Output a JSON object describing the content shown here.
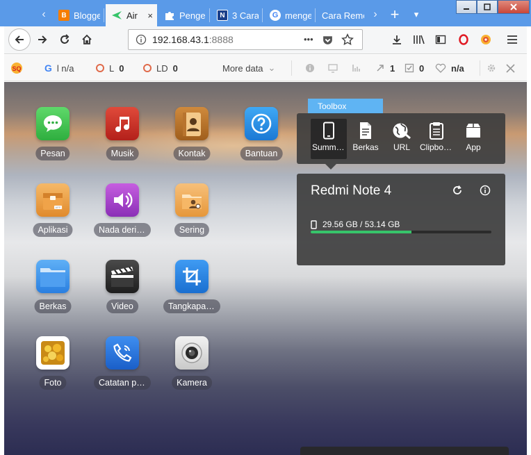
{
  "browser": {
    "tabs": [
      {
        "label": "Blogge",
        "favicon": "blogger-icon",
        "color": "#f57d00",
        "glyph": "B"
      },
      {
        "label": "Air",
        "favicon": "airdroid-icon",
        "color": "#37c46a",
        "glyph": "",
        "active": true
      },
      {
        "label": "Penge",
        "favicon": "puzzle-icon",
        "color": "#ffffff",
        "glyph": ""
      },
      {
        "label": "3 Cara",
        "favicon": "n-icon",
        "color": "#1a3f8a",
        "glyph": "N"
      },
      {
        "label": "menge",
        "favicon": "google-icon",
        "color": "#ffffff",
        "glyph": "G"
      },
      {
        "label": "Cara Remo",
        "favicon": "",
        "color": "",
        "glyph": ""
      }
    ],
    "new_tab": "+",
    "url": "192.168.43.1",
    "url_port": ":8888",
    "url_more": "•••"
  },
  "airdroid_bar": {
    "g_label": "l n/a",
    "l_label": "L",
    "l_value": "0",
    "ld_label": "LD",
    "ld_value": "0",
    "more_data": "More data",
    "arrow_count": "1",
    "check_count": "0",
    "health_value": "n/a"
  },
  "apps": [
    {
      "label": "Pesan",
      "icon": "message-icon"
    },
    {
      "label": "Musik",
      "icon": "music-icon"
    },
    {
      "label": "Kontak",
      "icon": "contact-icon"
    },
    {
      "label": "Bantuan",
      "icon": "help-icon"
    },
    {
      "label": "Aplikasi",
      "icon": "apps-box-icon"
    },
    {
      "label": "Nada dering",
      "icon": "ringtone-icon"
    },
    {
      "label": "Sering",
      "icon": "frequent-icon"
    },
    {
      "label": "Berkas",
      "icon": "folder-icon"
    },
    {
      "label": "Video",
      "icon": "clapper-icon"
    },
    {
      "label": "Tangkapan layar",
      "icon": "crop-icon"
    },
    {
      "label": "Foto",
      "icon": "photo-icon"
    },
    {
      "label": "Catatan panggilan",
      "icon": "call-log-icon"
    },
    {
      "label": "Kamera",
      "icon": "camera-icon"
    }
  ],
  "toolbox": {
    "title": "Toolbox",
    "items": [
      {
        "label": "Summary",
        "icon": "phone-icon"
      },
      {
        "label": "Berkas",
        "icon": "file-icon"
      },
      {
        "label": "URL",
        "icon": "globe-icon"
      },
      {
        "label": "Clipboard",
        "icon": "clipboard-icon"
      },
      {
        "label": "App",
        "icon": "app-box-icon"
      }
    ]
  },
  "device": {
    "name": "Redmi Note 4",
    "storage": "29.56 GB / 53.14 GB",
    "storage_used_fraction": 0.556
  },
  "colors": {
    "titlebar": "#5a9ae8",
    "accent_green": "#37c46a",
    "toolbox_blue": "#5fb4f3"
  }
}
